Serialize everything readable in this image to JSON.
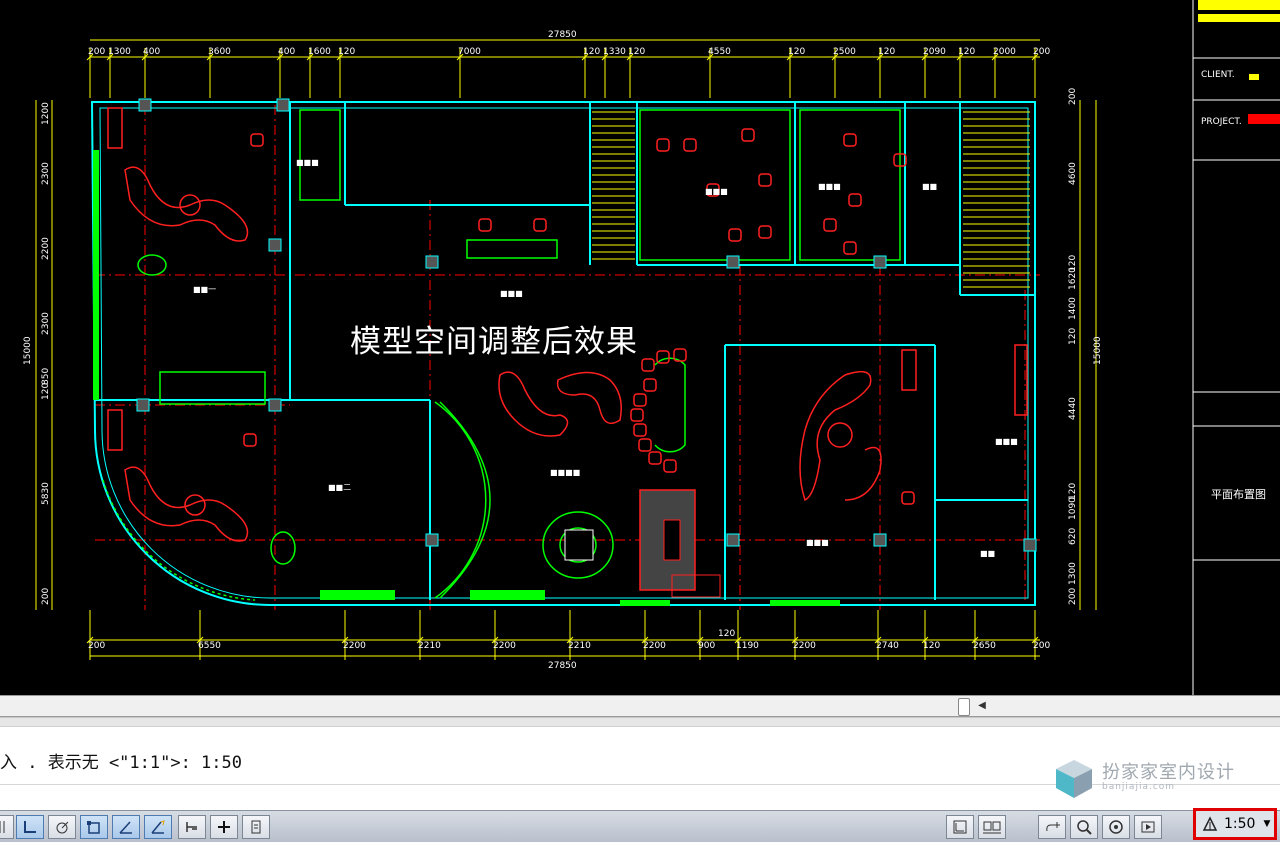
{
  "drawing": {
    "overlay_title": "模型空间调整后效果",
    "overall_dim_top": "27850",
    "overall_dim_bottom": "27850",
    "overall_dim_left": "15000",
    "overall_dim_right": "15000",
    "top_dims": [
      "200",
      "1300",
      "400",
      "3600",
      "400",
      "1600",
      "120",
      "7000",
      "120",
      "1330",
      "120",
      "4550",
      "120",
      "2500",
      "120",
      "2090",
      "120",
      "2000",
      "200"
    ],
    "bottom_dims": [
      "200",
      "6550",
      "2200",
      "2210",
      "2200",
      "2210",
      "2200",
      "900",
      "1190",
      "2200",
      "2740",
      "120",
      "2650",
      "200"
    ],
    "bottom_extra_dim": "120",
    "left_dims": [
      "1200",
      "2300",
      "2200",
      "2300",
      "850",
      "120",
      "5830",
      "200"
    ],
    "right_dims": [
      "200",
      "4600",
      "120",
      "1620",
      "1400",
      "120",
      "4440",
      "120",
      "1090",
      "620",
      "1300",
      "200"
    ]
  },
  "title_block": {
    "client_label": "CLIENT.",
    "project_label": "PROJECT.",
    "sheet_title": "平面布置图"
  },
  "command_line": {
    "prompt_text": "入 . 表示无 <\"1:1\">: 1:50"
  },
  "watermark": {
    "name": "扮家家室内设计",
    "url": "banjiajia.com"
  },
  "status_bar": {
    "annotation_scale": "1:50"
  },
  "colors": {
    "wall": "#00ffff",
    "furniture": "#ff2020",
    "green": "#00ff00",
    "dim": "#ffff00",
    "grid": "#ff0000",
    "highlight": "#e00000"
  }
}
